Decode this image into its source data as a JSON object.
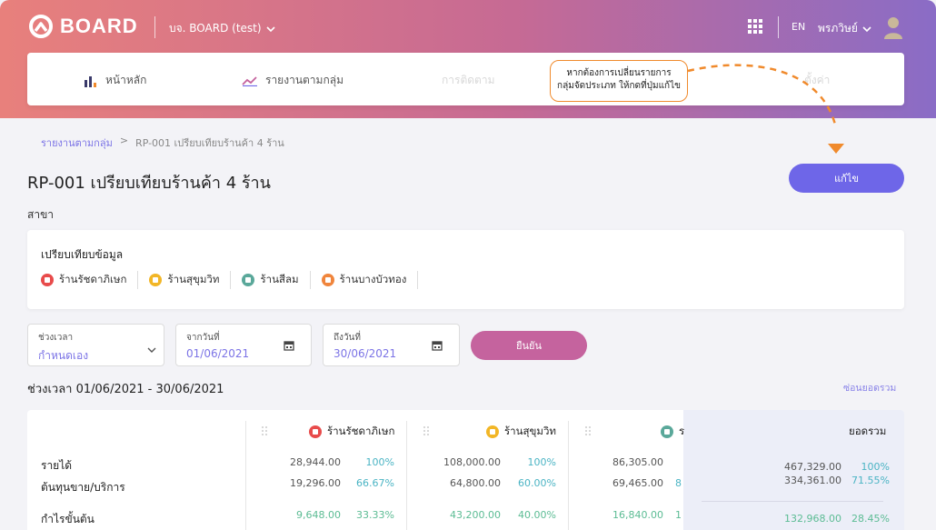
{
  "header": {
    "logo_text": "BOARD",
    "company": "บจ. BOARD (test)",
    "lang": "EN",
    "user": "พรภวิษย์"
  },
  "nav": {
    "home": "หน้าหลัก",
    "group_report": "รายงานตามกลุ่ม",
    "tracking": "การติดตาม",
    "settings": "ตั้งค่า"
  },
  "tooltip": {
    "line1": "หากต้องการเปลี่ยนรายการ",
    "line2": "กลุ่มจัดประเภท ให้กดที่ปุ่มแก้ไข"
  },
  "breadcrumb": {
    "parent": "รายงานตามกลุ่ม",
    "sep": ">",
    "current": "RP-001 เปรียบเทียบร้านค้า 4 ร้าน"
  },
  "page": {
    "title": "RP-001 เปรียบเทียบร้านค้า 4 ร้าน",
    "edit_label": "แก้ไข",
    "branch_label": "สาขา"
  },
  "compare": {
    "title": "เปรียบเทียบข้อมูล",
    "stores": [
      {
        "name": "ร้านรัชดาภิเษก",
        "color": "#e84b4b"
      },
      {
        "name": "ร้านสุขุมวิท",
        "color": "#f2b626"
      },
      {
        "name": "ร้านสีลม",
        "color": "#5aa89a"
      },
      {
        "name": "ร้านบางบัวทอง",
        "color": "#f0853c"
      }
    ]
  },
  "filters": {
    "period_label": "ช่วงเวลา",
    "period_value": "กำหนดเอง",
    "from_label": "จากวันที่",
    "from_value": "01/06/2021",
    "to_label": "ถึงวันที่",
    "to_value": "30/06/2021",
    "confirm_label": "ยืนยัน"
  },
  "period_text": "ช่วงเวลา 01/06/2021 - 30/06/2021",
  "hide_total_label": "ซ่อนยอดรวม",
  "table": {
    "columns": [
      {
        "name": "ร้านรัชดาภิเษก",
        "color": "#e84b4b"
      },
      {
        "name": "ร้านสุขุมวิท",
        "color": "#f2b626"
      },
      {
        "name": "ร",
        "color": "#5aa89a"
      }
    ],
    "total_label": "ยอดรวม",
    "rows": [
      {
        "label": "รายได้",
        "cells": [
          {
            "value": "28,944.00",
            "pct": "100%"
          },
          {
            "value": "108,000.00",
            "pct": "100%"
          },
          {
            "value": "86,305.00",
            "pct": ""
          }
        ],
        "total": {
          "value": "467,329.00",
          "pct": "100%"
        }
      },
      {
        "label": "ต้นทุนขาย/บริการ",
        "cells": [
          {
            "value": "19,296.00",
            "pct": "66.67%"
          },
          {
            "value": "64,800.00",
            "pct": "60.00%"
          },
          {
            "value": "69,465.00",
            "pct": "8"
          }
        ],
        "total": {
          "value": "334,361.00",
          "pct": "71.55%"
        }
      },
      {
        "label": "กำไรขั้นต้น",
        "cells": [
          {
            "value": "9,648.00",
            "pct": "33.33%"
          },
          {
            "value": "43,200.00",
            "pct": "40.00%"
          },
          {
            "value": "16,840.00",
            "pct": "1"
          }
        ],
        "total": {
          "value": "132,968.00",
          "pct": "28.45%"
        }
      }
    ]
  },
  "colors": {
    "accent": "#6e66e8",
    "confirm": "#c5639e",
    "tooltip_border": "#f08a2c",
    "pct": "#4bb4c4",
    "profit": "#5cbc94"
  }
}
